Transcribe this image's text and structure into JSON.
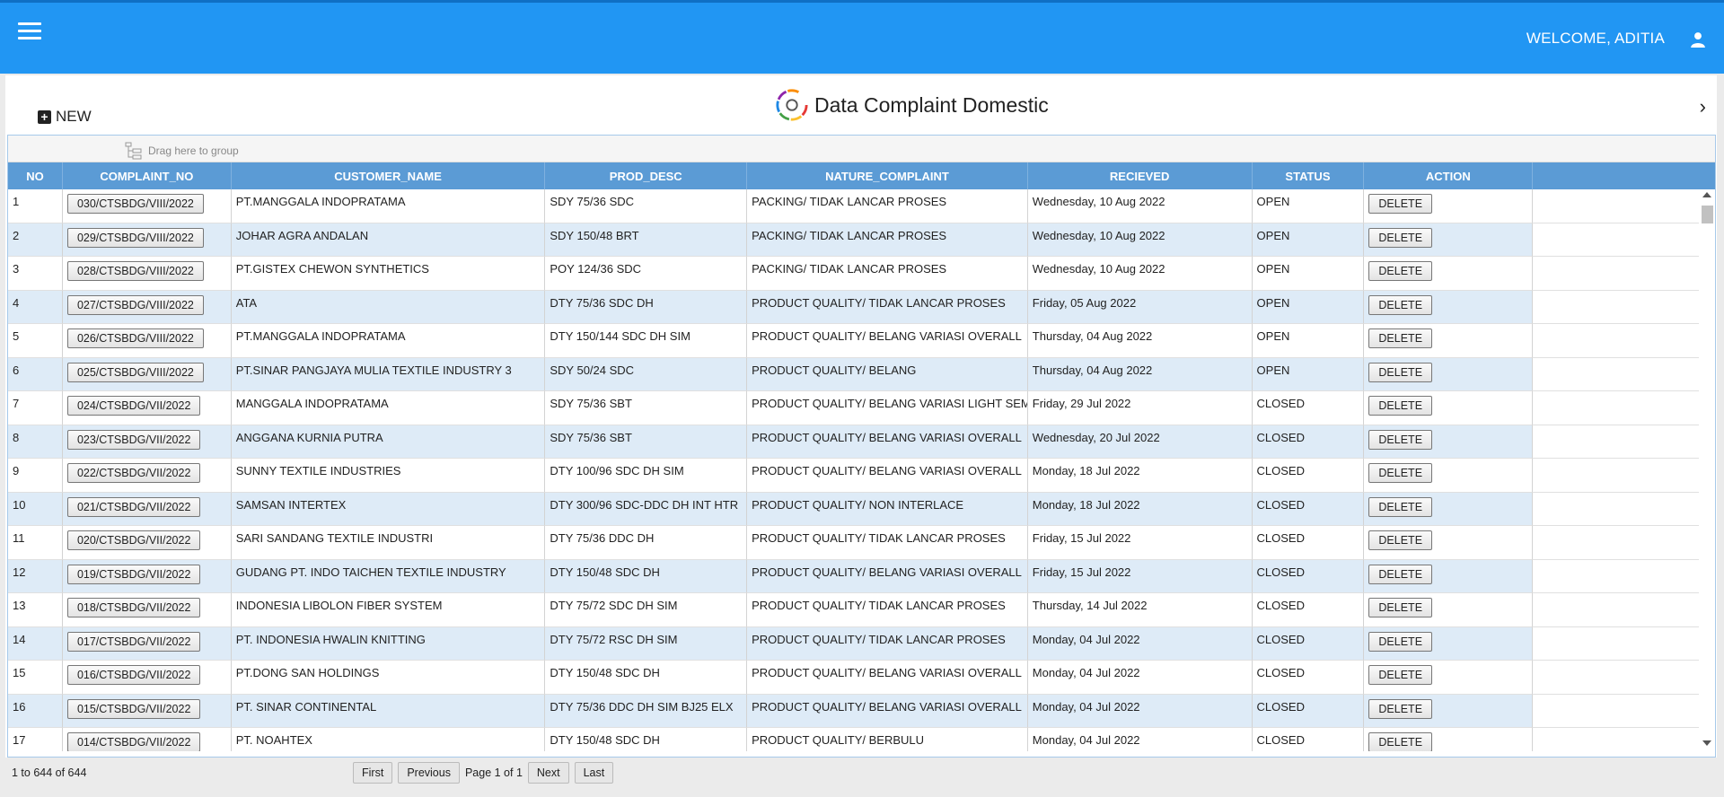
{
  "header": {
    "welcome": "WELCOME, ADITIA"
  },
  "toolbar": {
    "new_label": "NEW",
    "title": "Data Complaint Domestic"
  },
  "grid": {
    "group_hint": "Drag here to group",
    "columns": [
      "NO",
      "COMPLAINT_NO",
      "CUSTOMER_NAME",
      "PROD_DESC",
      "NATURE_COMPLAINT",
      "RECIEVED",
      "STATUS",
      "ACTION"
    ],
    "rows": [
      {
        "no": "1",
        "complaint_no": "030/CTSBDG/VIII/2022",
        "customer": "PT.MANGGALA INDOPRATAMA",
        "prod": "SDY 75/36 SDC",
        "nature": "PACKING/ TIDAK LANCAR PROSES",
        "received": "Wednesday, 10 Aug 2022",
        "status": "OPEN",
        "action": "DELETE"
      },
      {
        "no": "2",
        "complaint_no": "029/CTSBDG/VIII/2022",
        "customer": "JOHAR AGRA ANDALAN",
        "prod": "SDY 150/48 BRT",
        "nature": "PACKING/ TIDAK LANCAR PROSES",
        "received": "Wednesday, 10 Aug 2022",
        "status": "OPEN",
        "action": "DELETE"
      },
      {
        "no": "3",
        "complaint_no": "028/CTSBDG/VIII/2022",
        "customer": "PT.GISTEX CHEWON SYNTHETICS",
        "prod": "POY 124/36 SDC",
        "nature": "PACKING/ TIDAK LANCAR PROSES",
        "received": "Wednesday, 10 Aug 2022",
        "status": "OPEN",
        "action": "DELETE"
      },
      {
        "no": "4",
        "complaint_no": "027/CTSBDG/VIII/2022",
        "customer": "ATA",
        "prod": "DTY 75/36 SDC DH",
        "nature": "PRODUCT QUALITY/ TIDAK LANCAR PROSES",
        "received": "Friday, 05 Aug 2022",
        "status": "OPEN",
        "action": "DELETE"
      },
      {
        "no": "5",
        "complaint_no": "026/CTSBDG/VIII/2022",
        "customer": "PT.MANGGALA INDOPRATAMA",
        "prod": "DTY 150/144 SDC DH SIM",
        "nature": "PRODUCT QUALITY/ BELANG VARIASI OVERALL",
        "received": "Thursday, 04 Aug 2022",
        "status": "OPEN",
        "action": "DELETE"
      },
      {
        "no": "6",
        "complaint_no": "025/CTSBDG/VIII/2022",
        "customer": "PT.SINAR PANGJAYA MULIA TEXTILE INDUSTRY 3",
        "prod": "SDY 50/24 SDC",
        "nature": "PRODUCT QUALITY/ BELANG",
        "received": "Thursday, 04 Aug 2022",
        "status": "OPEN",
        "action": "DELETE"
      },
      {
        "no": "7",
        "complaint_no": "024/CTSBDG/VII/2022",
        "customer": "MANGGALA INDOPRATAMA",
        "prod": "SDY 75/36 SBT",
        "nature": "PRODUCT QUALITY/ BELANG VARIASI LIGHT SEM",
        "received": "Friday, 29 Jul 2022",
        "status": "CLOSED",
        "action": "DELETE"
      },
      {
        "no": "8",
        "complaint_no": "023/CTSBDG/VII/2022",
        "customer": "ANGGANA KURNIA PUTRA",
        "prod": "SDY 75/36 SBT",
        "nature": "PRODUCT QUALITY/ BELANG VARIASI OVERALL",
        "received": "Wednesday, 20 Jul 2022",
        "status": "CLOSED",
        "action": "DELETE"
      },
      {
        "no": "9",
        "complaint_no": "022/CTSBDG/VII/2022",
        "customer": "SUNNY TEXTILE INDUSTRIES",
        "prod": "DTY 100/96 SDC DH SIM",
        "nature": "PRODUCT QUALITY/ BELANG VARIASI OVERALL",
        "received": "Monday, 18 Jul 2022",
        "status": "CLOSED",
        "action": "DELETE"
      },
      {
        "no": "10",
        "complaint_no": "021/CTSBDG/VII/2022",
        "customer": "SAMSAN INTERTEX",
        "prod": "DTY 300/96 SDC-DDC DH INT HTR",
        "nature": "PRODUCT QUALITY/ NON INTERLACE",
        "received": "Monday, 18 Jul 2022",
        "status": "CLOSED",
        "action": "DELETE"
      },
      {
        "no": "11",
        "complaint_no": "020/CTSBDG/VII/2022",
        "customer": "SARI SANDANG TEXTILE INDUSTRI",
        "prod": "DTY 75/36 DDC DH",
        "nature": "PRODUCT QUALITY/ TIDAK LANCAR PROSES",
        "received": "Friday, 15 Jul 2022",
        "status": "CLOSED",
        "action": "DELETE"
      },
      {
        "no": "12",
        "complaint_no": "019/CTSBDG/VII/2022",
        "customer": "GUDANG PT. INDO TAICHEN TEXTILE INDUSTRY",
        "prod": "DTY 150/48 SDC DH",
        "nature": "PRODUCT QUALITY/ BELANG VARIASI OVERALL",
        "received": "Friday, 15 Jul 2022",
        "status": "CLOSED",
        "action": "DELETE"
      },
      {
        "no": "13",
        "complaint_no": "018/CTSBDG/VII/2022",
        "customer": "INDONESIA LIBOLON FIBER SYSTEM",
        "prod": "DTY 75/72 SDC DH SIM",
        "nature": "PRODUCT QUALITY/ TIDAK LANCAR PROSES",
        "received": "Thursday, 14 Jul 2022",
        "status": "CLOSED",
        "action": "DELETE"
      },
      {
        "no": "14",
        "complaint_no": "017/CTSBDG/VII/2022",
        "customer": "PT. INDONESIA HWALIN KNITTING",
        "prod": "DTY 75/72 RSC DH SIM",
        "nature": "PRODUCT QUALITY/ TIDAK LANCAR PROSES",
        "received": "Monday, 04 Jul 2022",
        "status": "CLOSED",
        "action": "DELETE"
      },
      {
        "no": "15",
        "complaint_no": "016/CTSBDG/VII/2022",
        "customer": "PT.DONG SAN HOLDINGS",
        "prod": "DTY 150/48 SDC DH",
        "nature": "PRODUCT QUALITY/ BELANG VARIASI OVERALL",
        "received": "Monday, 04 Jul 2022",
        "status": "CLOSED",
        "action": "DELETE"
      },
      {
        "no": "16",
        "complaint_no": "015/CTSBDG/VII/2022",
        "customer": "PT. SINAR CONTINENTAL",
        "prod": "DTY 75/36 DDC DH SIM BJ25 ELX",
        "nature": "PRODUCT QUALITY/ BELANG VARIASI OVERALL",
        "received": "Monday, 04 Jul 2022",
        "status": "CLOSED",
        "action": "DELETE"
      },
      {
        "no": "17",
        "complaint_no": "014/CTSBDG/VII/2022",
        "customer": "PT. NOAHTEX",
        "prod": "DTY 150/48 SDC DH",
        "nature": "PRODUCT QUALITY/ BERBULU",
        "received": "Monday, 04 Jul 2022",
        "status": "CLOSED",
        "action": "DELETE"
      }
    ]
  },
  "footer": {
    "range": "1 to 644 of 644",
    "first": "First",
    "previous": "Previous",
    "page_info": "Page 1 of 1",
    "next": "Next",
    "last": "Last"
  },
  "colors": {
    "topbar": "#2196f3",
    "header": "#5b9bd5",
    "row_alt": "#deebf7"
  },
  "icons": {
    "menu": "hamburger-icon",
    "user": "user-icon",
    "new": "plus-square-icon",
    "expand": "chevron-right-icon",
    "group": "tree-icon"
  }
}
